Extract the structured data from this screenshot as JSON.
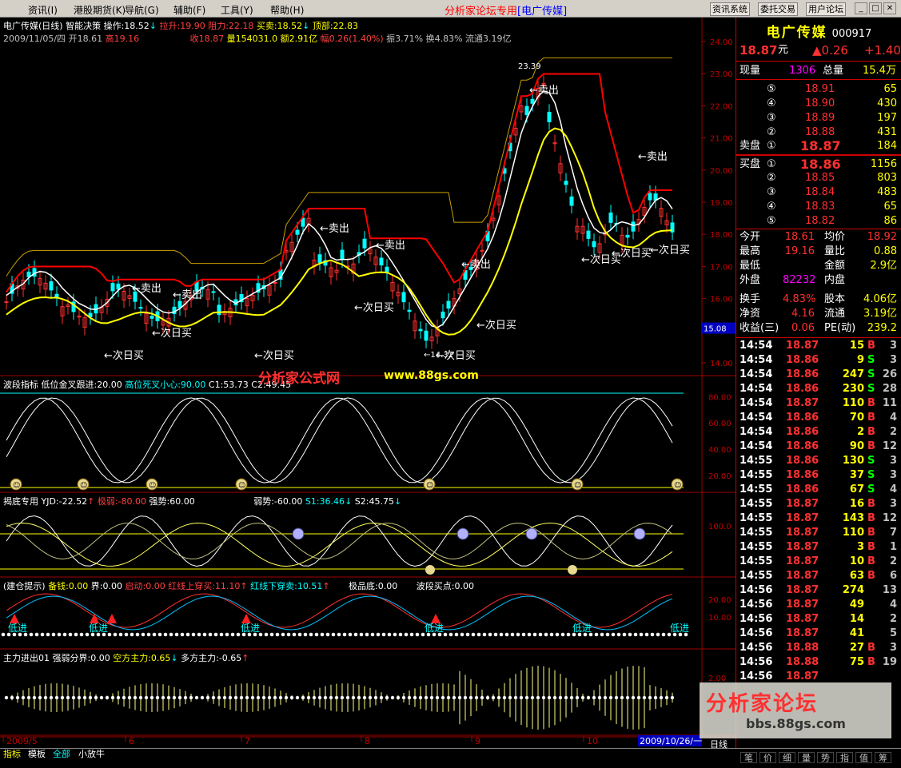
{
  "menu": {
    "items": [
      "资讯",
      "港股期货",
      "导航",
      "辅助",
      "工具",
      "帮助"
    ],
    "keys": [
      "(I)",
      "(K)",
      "(G)",
      "(F)",
      "(Y)",
      "(H)"
    ],
    "site_title": "分析家论坛专用",
    "site_sub": "[电广传媒]",
    "btn1": "资讯系统",
    "btn2": "委托交易",
    "btn3": "用户论坛"
  },
  "header": {
    "line1_name": "电广传媒(日线) 智能决策",
    "op": "操作:18.52",
    "pull": "拉升:19.90",
    "resist": "阻力:22.18",
    "buysell": "买卖:18.52",
    "top": "顶部:22.83",
    "line2_date": "2009/11/05/四",
    "open": "开18.61",
    "high": "高19.16",
    "close": "收18.87",
    "vol": "量154031.0",
    "amt": "额2.91亿",
    "chg": "幅0.26(1.40%)",
    "amp": "振3.71%",
    "turn": "换4.83%",
    "float": "流通3.19亿"
  },
  "indicators": {
    "p2_title": "波段指标 低位金叉跟进:20.00",
    "p2_hi": "高位死叉小心:90.00",
    "p2_c1": "C1:53.73",
    "p2_c2": "C2:49.45",
    "p3_title": "揭底专用",
    "p3_yjd": "YJD:-22.52",
    "p3_jr": "极弱:-80.00",
    "p3_qs": "强势:60.00",
    "p3_rs": "弱势:-60.00",
    "p3_s1": "S1:36.46",
    "p3_s2": "S2:45.75",
    "p4_title": "(建仓提示)",
    "p4_bq": "备钱:0.00",
    "p4_jie": "界:0.00",
    "p4_qd": "启动:0.00",
    "p4_hx": "红线上穿买:11.10",
    "p4_lx": "红线下穿卖:10.51",
    "p4_jpd": "极品底:0.00",
    "p4_bdmd": "波段买点:0.00",
    "p5_title": "主力进出01",
    "p5_qr": "强弱分界:0.00",
    "p5_kf": "空方主力:0.65",
    "p5_df": "多方主力:-0.65"
  },
  "annotations": {
    "sell": "←卖出",
    "buy": "←次日买",
    "high_val": "23.39",
    "low_val": "←14.32",
    "jiaxin": "致",
    "dijin": "低进"
  },
  "axis": {
    "main_ticks": [
      "24.00",
      "23.00",
      "22.00",
      "21.00",
      "20.00",
      "19.00",
      "18.00",
      "17.00",
      "16.00",
      "15.08",
      "14.00"
    ],
    "p2_ticks": [
      "80.00",
      "60.00",
      "40.00",
      "20.00"
    ],
    "p3_ticks": [
      "100.0"
    ],
    "p4_ticks": [
      "20.00",
      "10.00"
    ],
    "p5_ticks": [
      "2.00"
    ],
    "dates": [
      "2009/5",
      "6",
      "7",
      "8",
      "9",
      "10"
    ],
    "cursor_date": "2009/10/26/一"
  },
  "watermarks": {
    "wm1": "分析家公式网",
    "wm2": "www.88gs.com",
    "wm3": "分析家论坛",
    "wm4": "bbs.88gs.com"
  },
  "quote": {
    "name": "电广传媒",
    "code": "000917",
    "price": "18.87",
    "price_unit": "元",
    "chg": "▲0.26",
    "chg2": "+1.40",
    "xl_label": "现量",
    "xl": "1306",
    "zl_label": "总量",
    "zl": "15.4万",
    "asks": [
      {
        "i": "⑤",
        "p": "18.91",
        "v": "65"
      },
      {
        "i": "④",
        "p": "18.90",
        "v": "430"
      },
      {
        "i": "③",
        "p": "18.89",
        "v": "197"
      },
      {
        "i": "②",
        "p": "18.88",
        "v": "431"
      }
    ],
    "ask1": {
      "label": "卖盘",
      "i": "①",
      "p": "18.87",
      "v": "184"
    },
    "bid1": {
      "label": "买盘",
      "i": "①",
      "p": "18.86",
      "v": "1156"
    },
    "bids": [
      {
        "i": "②",
        "p": "18.85",
        "v": "803"
      },
      {
        "i": "③",
        "p": "18.84",
        "v": "483"
      },
      {
        "i": "④",
        "p": "18.83",
        "v": "65"
      },
      {
        "i": "⑤",
        "p": "18.82",
        "v": "86"
      }
    ],
    "stats": [
      {
        "a": "今开",
        "av": "18.61",
        "b": "均价",
        "bv": "18.92"
      },
      {
        "a": "最高",
        "av": "19.16",
        "b": "量比",
        "bv": "0.88"
      },
      {
        "a": "最低",
        "av": "",
        "b": "金额",
        "bv": "2.9亿"
      },
      {
        "a": "外盘",
        "av": "82232",
        "b": "内盘",
        "bv": ""
      },
      {
        "a": "换手",
        "av": "4.83%",
        "b": "股本",
        "bv": "4.06亿"
      },
      {
        "a": "净资",
        "av": "4.16",
        "b": "流通",
        "bv": "3.19亿"
      },
      {
        "a": "收益(三)",
        "av": "0.06",
        "b": "PE(动)",
        "bv": "239.2"
      }
    ],
    "ticks": [
      {
        "t": "14:54",
        "p": "18.87",
        "v": "15",
        "f": "B",
        "n": "3"
      },
      {
        "t": "14:54",
        "p": "18.86",
        "v": "9",
        "f": "S",
        "n": "3"
      },
      {
        "t": "14:54",
        "p": "18.86",
        "v": "247",
        "f": "S",
        "n": "26"
      },
      {
        "t": "14:54",
        "p": "18.86",
        "v": "230",
        "f": "S",
        "n": "28"
      },
      {
        "t": "14:54",
        "p": "18.87",
        "v": "110",
        "f": "B",
        "n": "11"
      },
      {
        "t": "14:54",
        "p": "18.86",
        "v": "70",
        "f": "B",
        "n": "4"
      },
      {
        "t": "14:54",
        "p": "18.86",
        "v": "2",
        "f": "B",
        "n": "2"
      },
      {
        "t": "14:54",
        "p": "18.86",
        "v": "90",
        "f": "B",
        "n": "12"
      },
      {
        "t": "14:55",
        "p": "18.86",
        "v": "130",
        "f": "S",
        "n": "3"
      },
      {
        "t": "14:55",
        "p": "18.86",
        "v": "37",
        "f": "S",
        "n": "3"
      },
      {
        "t": "14:55",
        "p": "18.86",
        "v": "67",
        "f": "S",
        "n": "4"
      },
      {
        "t": "14:55",
        "p": "18.87",
        "v": "16",
        "f": "B",
        "n": "3"
      },
      {
        "t": "14:55",
        "p": "18.87",
        "v": "143",
        "f": "B",
        "n": "12"
      },
      {
        "t": "14:55",
        "p": "18.87",
        "v": "110",
        "f": "B",
        "n": "7"
      },
      {
        "t": "14:55",
        "p": "18.87",
        "v": "3",
        "f": "B",
        "n": "1"
      },
      {
        "t": "14:55",
        "p": "18.87",
        "v": "10",
        "f": "B",
        "n": "2"
      },
      {
        "t": "14:55",
        "p": "18.87",
        "v": "63",
        "f": "B",
        "n": "6"
      },
      {
        "t": "14:56",
        "p": "18.87",
        "v": "274",
        "f": "",
        "n": "13"
      },
      {
        "t": "14:56",
        "p": "18.87",
        "v": "49",
        "f": "",
        "n": "4"
      },
      {
        "t": "14:56",
        "p": "18.87",
        "v": "14",
        "f": "",
        "n": "2"
      },
      {
        "t": "14:56",
        "p": "18.87",
        "v": "41",
        "f": "",
        "n": "5"
      },
      {
        "t": "14:56",
        "p": "18.88",
        "v": "27",
        "f": "B",
        "n": "3"
      },
      {
        "t": "14:56",
        "p": "18.88",
        "v": "75",
        "f": "B",
        "n": "19"
      },
      {
        "t": "14:56",
        "p": "18.87",
        "v": "",
        "f": "",
        "n": ""
      }
    ]
  },
  "bottom": {
    "tabs": [
      "指标",
      "模板",
      "全部",
      "小放牛"
    ],
    "right_label": "日线",
    "rtabs": [
      "笔",
      "价",
      "细",
      "量",
      "势",
      "指",
      "值",
      "筹"
    ]
  }
}
